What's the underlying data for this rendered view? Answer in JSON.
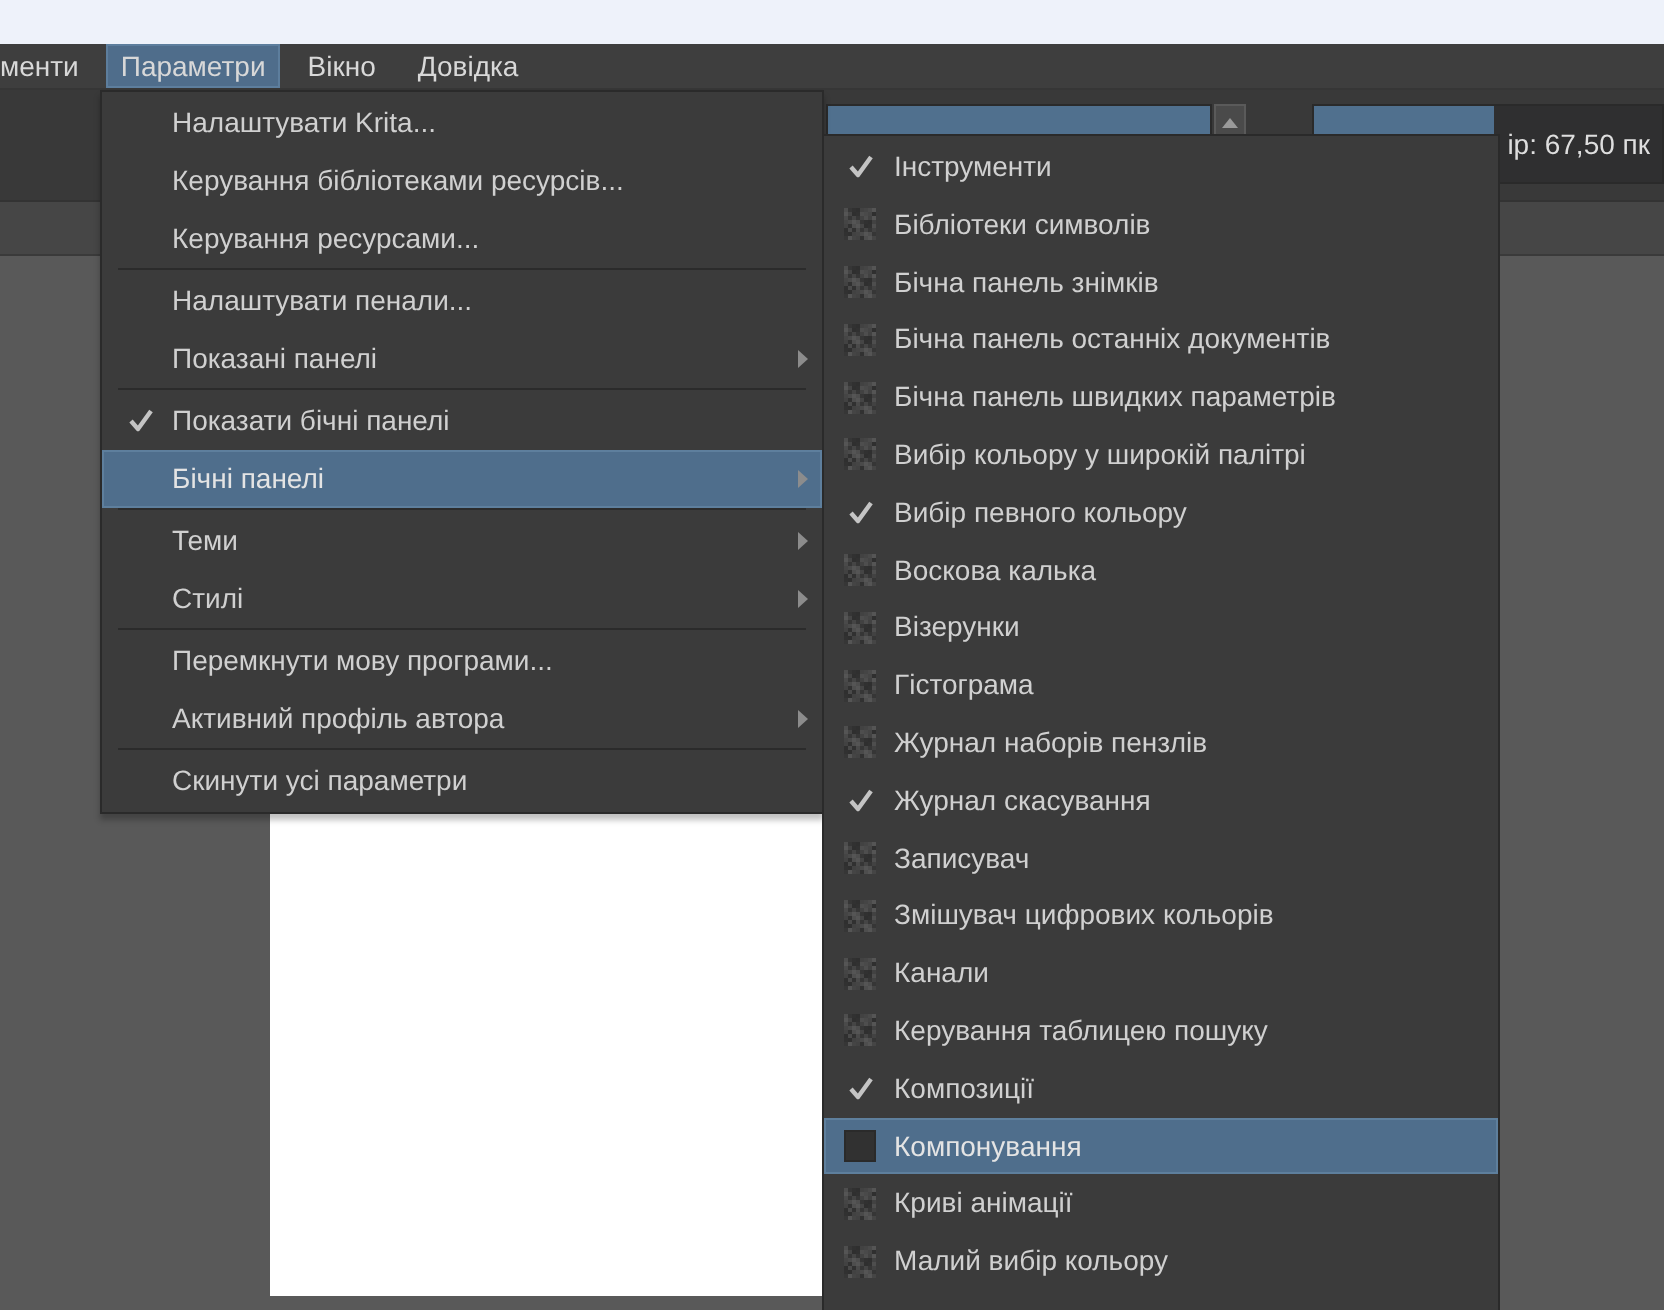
{
  "menu_bar": {
    "items": [
      {
        "label": "менти",
        "selected": false
      },
      {
        "label": "Параметри",
        "selected": true
      },
      {
        "label": "Вікно",
        "selected": false
      },
      {
        "label": "Довідка",
        "selected": false
      }
    ]
  },
  "tool_options": {
    "opacity_slider": {
      "level": 1
    },
    "size_slider": {
      "level": 0.52,
      "text": "ір: 67,50 пк"
    }
  },
  "settings_menu": {
    "groups": [
      {
        "items": [
          {
            "label": "Налаштувати Krita...",
            "checked": false,
            "submenu": false,
            "selected": false
          },
          {
            "label": "Керування бібліотеками ресурсів...",
            "checked": false,
            "submenu": false,
            "selected": false
          },
          {
            "label": "Керування ресурсами...",
            "checked": false,
            "submenu": false,
            "selected": false
          }
        ]
      },
      {
        "items": [
          {
            "label": "Налаштувати пенали...",
            "checked": false,
            "submenu": false,
            "selected": false
          },
          {
            "label": "Показані панелі",
            "checked": false,
            "submenu": true,
            "selected": false
          }
        ]
      },
      {
        "items": [
          {
            "label": "Показати бічні панелі",
            "checked": true,
            "submenu": false,
            "selected": false
          },
          {
            "label": "Бічні панелі",
            "checked": false,
            "submenu": true,
            "selected": true
          }
        ]
      },
      {
        "items": [
          {
            "label": "Теми",
            "checked": false,
            "submenu": true,
            "selected": false
          },
          {
            "label": "Стилі",
            "checked": false,
            "submenu": true,
            "selected": false
          }
        ]
      },
      {
        "items": [
          {
            "label": "Перемкнути мову програми...",
            "checked": false,
            "submenu": false,
            "selected": false
          },
          {
            "label": "Активний профіль автора",
            "checked": false,
            "submenu": true,
            "selected": false
          }
        ]
      },
      {
        "items": [
          {
            "label": "Скинути усі параметри",
            "checked": false,
            "submenu": false,
            "selected": false
          }
        ]
      }
    ]
  },
  "dockers_menu": {
    "items": [
      {
        "label": "Інструменти",
        "checked": true,
        "selected": false
      },
      {
        "label": "Бібліотеки символів",
        "checked": false,
        "selected": false
      },
      {
        "label": "Бічна панель знімків",
        "checked": false,
        "selected": false
      },
      {
        "label": "Бічна панель останніх документів",
        "checked": false,
        "selected": false
      },
      {
        "label": "Бічна панель швидких параметрів",
        "checked": false,
        "selected": false
      },
      {
        "label": "Вибір кольору у широкій палітрі",
        "checked": false,
        "selected": false
      },
      {
        "label": "Вибір певного кольору",
        "checked": true,
        "selected": false
      },
      {
        "label": "Воскова калька",
        "checked": false,
        "selected": false
      },
      {
        "label": "Візерунки",
        "checked": false,
        "selected": false
      },
      {
        "label": "Гістограма",
        "checked": false,
        "selected": false
      },
      {
        "label": "Журнал наборів пензлів",
        "checked": false,
        "selected": false
      },
      {
        "label": "Журнал скасування",
        "checked": true,
        "selected": false
      },
      {
        "label": "Записувач",
        "checked": false,
        "selected": false
      },
      {
        "label": "Змішувач цифрових кольорів",
        "checked": false,
        "selected": false
      },
      {
        "label": "Канали",
        "checked": false,
        "selected": false
      },
      {
        "label": "Керування таблицею пошуку",
        "checked": false,
        "selected": false
      },
      {
        "label": "Композиції",
        "checked": true,
        "selected": false
      },
      {
        "label": "Компонування",
        "checked": false,
        "selected": true
      },
      {
        "label": "Криві анімації",
        "checked": false,
        "selected": false
      },
      {
        "label": "Малий вибір кольору",
        "checked": false,
        "selected": false
      }
    ]
  }
}
